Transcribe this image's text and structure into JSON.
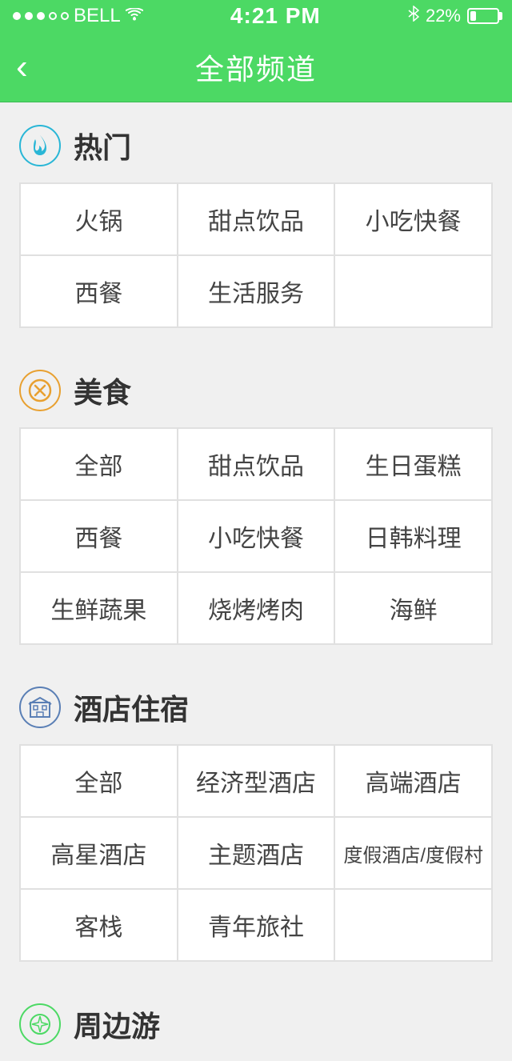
{
  "statusBar": {
    "carrier": "BELL",
    "time": "4:21 PM",
    "battery": "22%"
  },
  "nav": {
    "back_label": "‹",
    "title": "全部频道"
  },
  "sections": [
    {
      "id": "hot",
      "icon_type": "hot",
      "title": "热门",
      "items": [
        [
          "火锅",
          "甜点饮品",
          "小吃快餐"
        ],
        [
          "西餐",
          "生活服务",
          ""
        ]
      ]
    },
    {
      "id": "food",
      "icon_type": "food",
      "title": "美食",
      "items": [
        [
          "全部",
          "甜点饮品",
          "生日蛋糕"
        ],
        [
          "西餐",
          "小吃快餐",
          "日韩料理"
        ],
        [
          "生鲜蔬果",
          "烧烤烤肉",
          "海鲜"
        ]
      ]
    },
    {
      "id": "hotel",
      "icon_type": "hotel",
      "title": "酒店住宿",
      "items": [
        [
          "全部",
          "经济型酒店",
          "高端酒店"
        ],
        [
          "高星酒店",
          "主题酒店",
          "度假酒店/度假村"
        ],
        [
          "客栈",
          "青年旅社",
          ""
        ]
      ]
    },
    {
      "id": "nearby",
      "icon_type": "nearby",
      "title": "周边游",
      "items": []
    }
  ]
}
